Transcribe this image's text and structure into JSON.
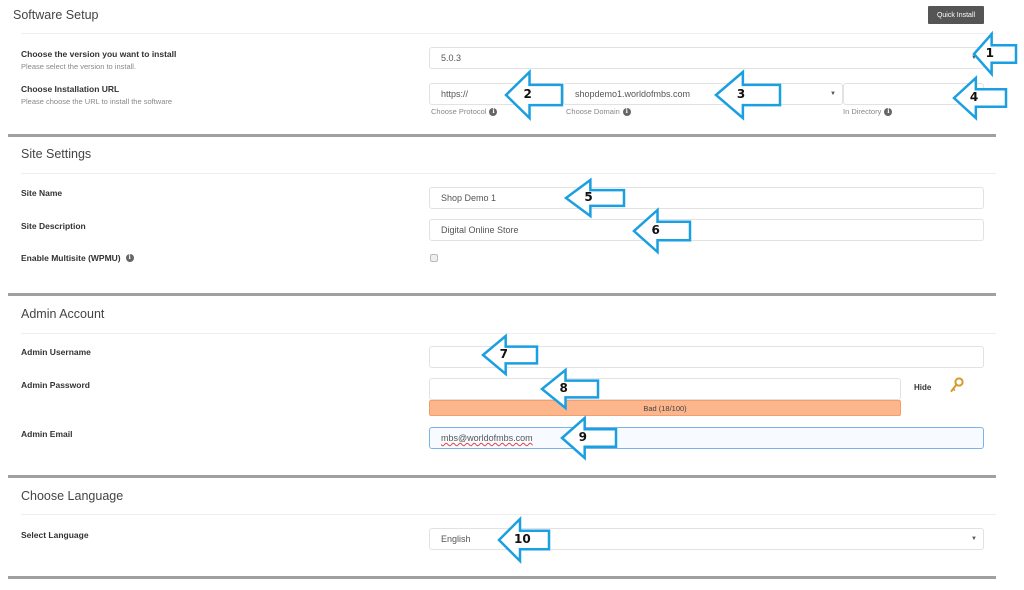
{
  "software_setup": {
    "title": "Software Setup",
    "quick_install_label": "Quick Install",
    "version": {
      "label": "Choose the version you want to install",
      "sublabel": "Please select the version to install.",
      "value": "5.0.3"
    },
    "url": {
      "label": "Choose Installation URL",
      "sublabel": "Please choose the URL to install the software",
      "protocol_value": "https://",
      "protocol_hint": "Choose Protocol",
      "domain_value": "shopdemo1.worldofmbs.com",
      "domain_hint": "Choose Domain",
      "directory_value": "",
      "directory_hint": "In Directory"
    }
  },
  "site_settings": {
    "title": "Site Settings",
    "site_name_label": "Site Name",
    "site_name_value": "Shop Demo 1",
    "site_description_label": "Site Description",
    "site_description_value": "Digital Online Store",
    "multisite_label": "Enable Multisite (WPMU)",
    "multisite_checked": false
  },
  "admin_account": {
    "title": "Admin Account",
    "username_label": "Admin Username",
    "username_value": "",
    "password_label": "Admin Password",
    "password_value": "",
    "hide_label": "Hide",
    "strength_text": "Bad (18/100)",
    "strength_score": 18,
    "email_label": "Admin Email",
    "email_value": "mbs@worldofmbs.com"
  },
  "language": {
    "title": "Choose Language",
    "select_label": "Select Language",
    "value": "English"
  },
  "annotations": {
    "color": "#1a9fe0",
    "arrows": [
      "1",
      "2",
      "3",
      "4",
      "5",
      "6",
      "7",
      "8",
      "9",
      "10"
    ]
  },
  "icons": {
    "info": "i",
    "caret": "▼"
  }
}
